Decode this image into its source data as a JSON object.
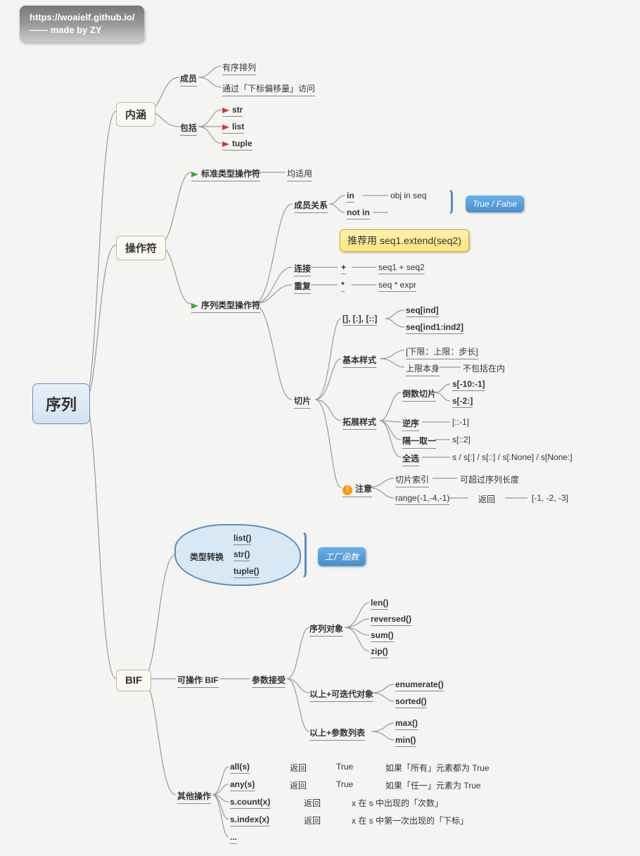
{
  "watermark": {
    "line1": "https://woaielf.github.io/",
    "line2": "—— made by ZY"
  },
  "root": "序列",
  "main": {
    "n1": "内涵",
    "n2": "操作符",
    "n3": "BIF"
  },
  "neiran": {
    "member": "成员",
    "m1": "有序排列",
    "m2": "通过「下标偏移量」访问",
    "include": "包括",
    "i1": "str",
    "i2": "list",
    "i3": "tuple"
  },
  "ops": {
    "std": "标准类型操作符",
    "std_v": "均适用",
    "seq": "序列类型操作符",
    "mem": "成员关系",
    "in": "in",
    "notin": "not in",
    "in_v": "obj in seq",
    "tf": "True / False",
    "conn": "连接",
    "conn_op": "+",
    "conn_v": "seq1 + seq2",
    "conn_rec": "推荐用 seq1.extend(seq2)",
    "rep": "重复",
    "rep_op": "*",
    "rep_v": "seq * expr",
    "slice": "切片",
    "idx": "[], [:], [::]",
    "idx1": "seq[ind]",
    "idx2": "seq[ind1:ind2]",
    "basic": "基本样式",
    "b1": "[下限：上限：步长]",
    "b2a": "上限本身",
    "b2b": "不包括在内",
    "ext": "拓展样式",
    "neg": "倒数切片",
    "neg1": "s[-10:-1]",
    "neg2": "s[-2:]",
    "rev": "逆序",
    "rev_v": "[::-1]",
    "skip": "隔一取一",
    "skip_v": "s[::2]",
    "all": "全选",
    "all_v": "s / s[:] / s[::] / s[:None] / s[None:]",
    "note": "注意",
    "note1a": "切片索引",
    "note1b": "可超过序列长度",
    "note2a": "range(-1,-4,-1)",
    "note2b": "返回",
    "note2c": "[-1, -2, -3]"
  },
  "bif": {
    "conv": "类型转换",
    "c1": "list()",
    "c2": "str()",
    "c3": "tuple()",
    "fac": "工厂函数",
    "opbif": "可操作 BIF",
    "param": "参数接受",
    "seqobj": "序列对象",
    "s1": "len()",
    "s2": "reversed()",
    "s3": "sum()",
    "s4": "zip()",
    "iter": "以上+可迭代对象",
    "i1": "enumerate()",
    "i2": "sorted()",
    "plist": "以上+参数列表",
    "p1": "max()",
    "p2": "min()",
    "other": "其他操作",
    "o1": "all(s)",
    "o1r": "返回",
    "o1t": "True",
    "o1v": "如果「所有」元素都为 True",
    "o2": "any(s)",
    "o2r": "返回",
    "o2t": "True",
    "o2v": "如果「任一」元素为 True",
    "o3": "s.count(x)",
    "o3r": "返回",
    "o3v": "x 在 s 中出现的「次数」",
    "o4": "s.index(x)",
    "o4r": "返回",
    "o4v": "x 在 s 中第一次出现的「下标」",
    "o5": "..."
  }
}
